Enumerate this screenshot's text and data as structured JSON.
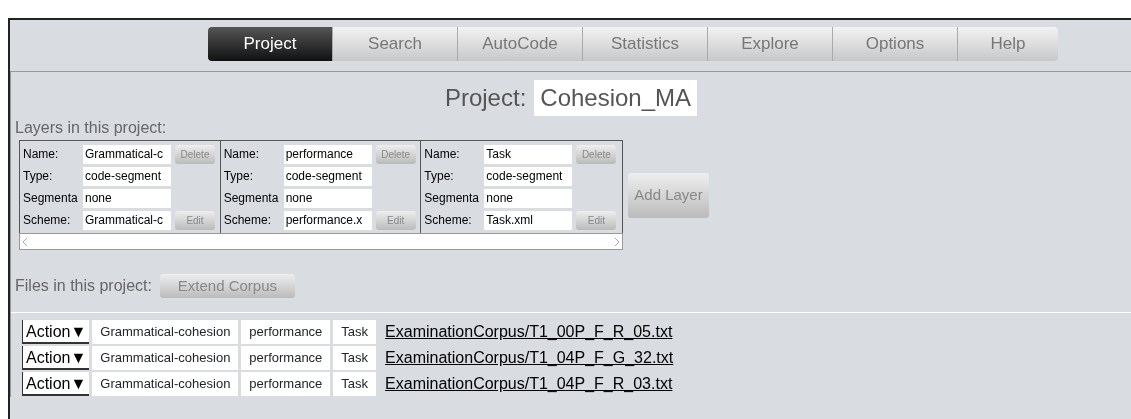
{
  "tabs": [
    {
      "label": "Project",
      "selected": true
    },
    {
      "label": "Search",
      "selected": false
    },
    {
      "label": "AutoCode",
      "selected": false
    },
    {
      "label": "Statistics",
      "selected": false
    },
    {
      "label": "Explore",
      "selected": false
    },
    {
      "label": "Options",
      "selected": false
    },
    {
      "label": "Help",
      "selected": false
    }
  ],
  "project": {
    "label": "Project:",
    "name": "Cohesion_MA"
  },
  "layers_heading": "Layers in this project:",
  "layers": [
    {
      "name_label": "Name:",
      "name": "Grammatical-c",
      "delete": "Delete",
      "type_label": "Type:",
      "type": "code-segment",
      "segmentation_label": "Segmenta",
      "segmentation": "none",
      "scheme_label": "Scheme:",
      "scheme": "Grammatical-c",
      "edit": "Edit"
    },
    {
      "name_label": "Name:",
      "name": "performance",
      "delete": "Delete",
      "type_label": "Type:",
      "type": "code-segment",
      "segmentation_label": "Segmenta",
      "segmentation": "none",
      "scheme_label": "Scheme:",
      "scheme": "performance.x",
      "edit": "Edit"
    },
    {
      "name_label": "Name:",
      "name": "Task",
      "delete": "Delete",
      "type_label": "Type:",
      "type": "code-segment",
      "segmentation_label": "Segmenta",
      "segmentation": "none",
      "scheme_label": "Scheme:",
      "scheme": "Task.xml",
      "edit": "Edit"
    }
  ],
  "add_layer": "Add Layer",
  "files_heading": "Files in this project:",
  "extend_corpus": "Extend Corpus",
  "files": [
    {
      "action": "Action▼",
      "layers": [
        "Grammatical-cohesion",
        "performance",
        "Task"
      ],
      "path": "ExaminationCorpus/T1_00P_F_R_05.txt"
    },
    {
      "action": "Action▼",
      "layers": [
        "Grammatical-cohesion",
        "performance",
        "Task"
      ],
      "path": "ExaminationCorpus/T1_04P_F_G_32.txt"
    },
    {
      "action": "Action▼",
      "layers": [
        "Grammatical-cohesion",
        "performance",
        "Task"
      ],
      "path": "ExaminationCorpus/T1_04P_F_R_03.txt"
    }
  ]
}
